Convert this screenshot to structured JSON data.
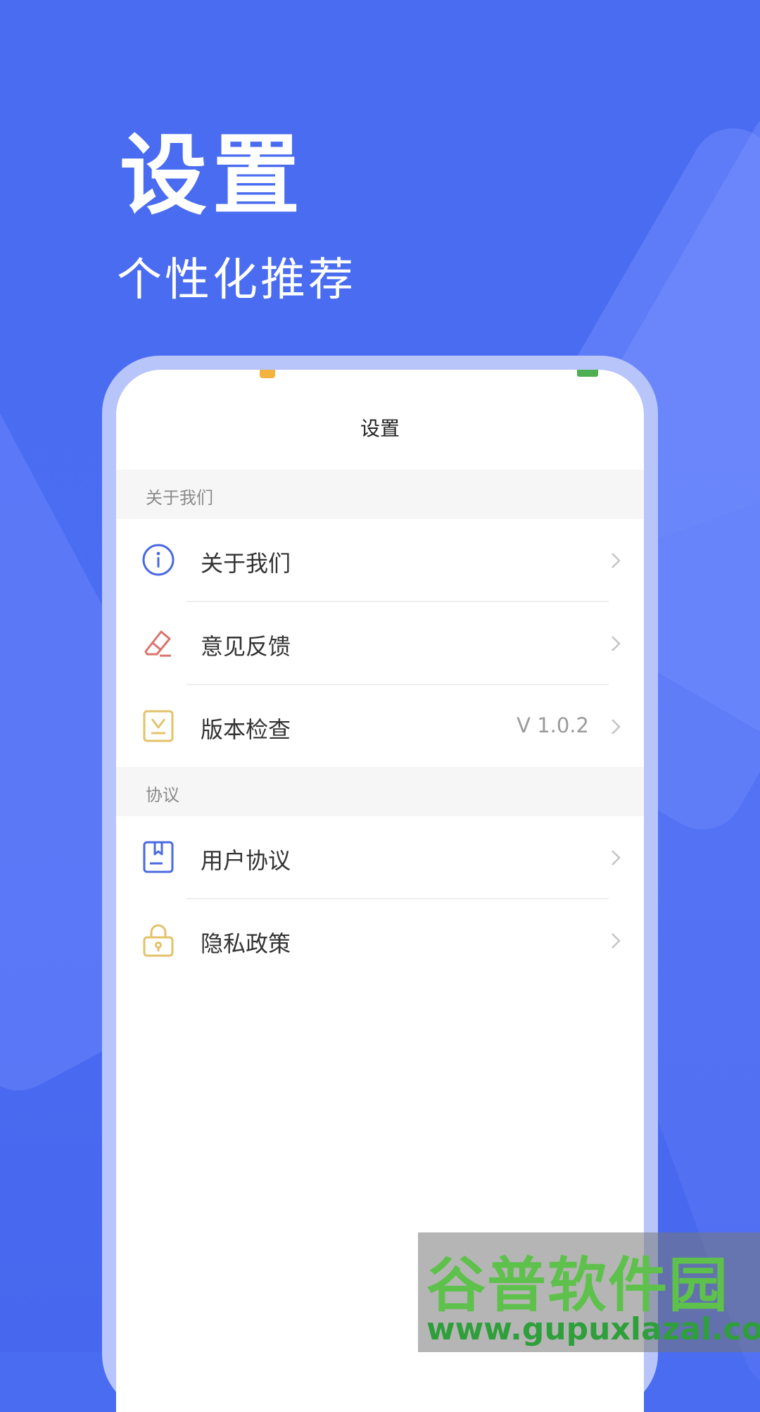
{
  "hero": {
    "title": "设置",
    "subtitle": "个性化推荐"
  },
  "screen": {
    "nav_title": "设置",
    "sections": [
      {
        "header": "关于我们"
      },
      {
        "header": "协议"
      }
    ],
    "items": {
      "about": {
        "label": "关于我们",
        "icon": "info-icon"
      },
      "feedback": {
        "label": "意见反馈",
        "icon": "eraser-icon"
      },
      "version": {
        "label": "版本检查",
        "value": "V 1.0.2",
        "icon": "download-box-icon"
      },
      "user_agreement": {
        "label": "用户协议",
        "icon": "bookmark-doc-icon"
      },
      "privacy": {
        "label": "隐私政策",
        "icon": "lock-icon"
      }
    }
  },
  "watermark": {
    "line1": "谷普软件园",
    "line2": "www.gupuxlazal.com"
  },
  "colors": {
    "background": "#4a6cf0",
    "phone_frame": "#b8c5fb",
    "icon_blue": "#4a6ae0",
    "icon_red": "#d9746e",
    "icon_yellow": "#e3c26a"
  }
}
